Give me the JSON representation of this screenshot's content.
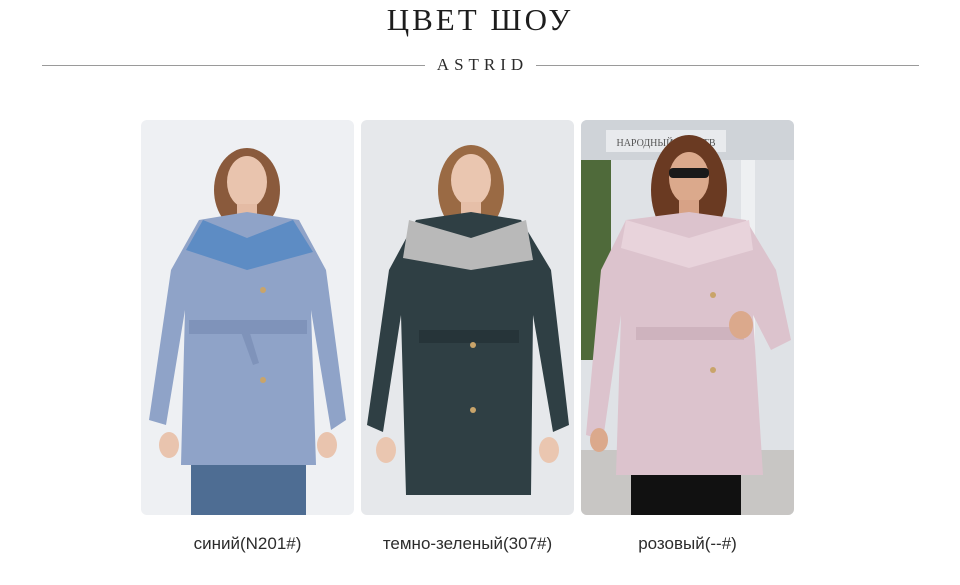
{
  "header": {
    "title": "ЦВЕТ ШОУ",
    "brand": "ASTRID"
  },
  "products": [
    {
      "color_label": "синий(N201#)",
      "coat_color": "#8fa3c8",
      "collar_color": "#5d8cc4"
    },
    {
      "color_label": "темно-зеленый(307#)",
      "coat_color": "#2f3f44",
      "collar_color": "#b9b9b9"
    },
    {
      "color_label": "розовый(--#)",
      "coat_color": "#dcc3cd",
      "collar_color": "#e8d3db"
    }
  ],
  "store_sign": "НАРОДНЫЙ ЧУВСТВ"
}
